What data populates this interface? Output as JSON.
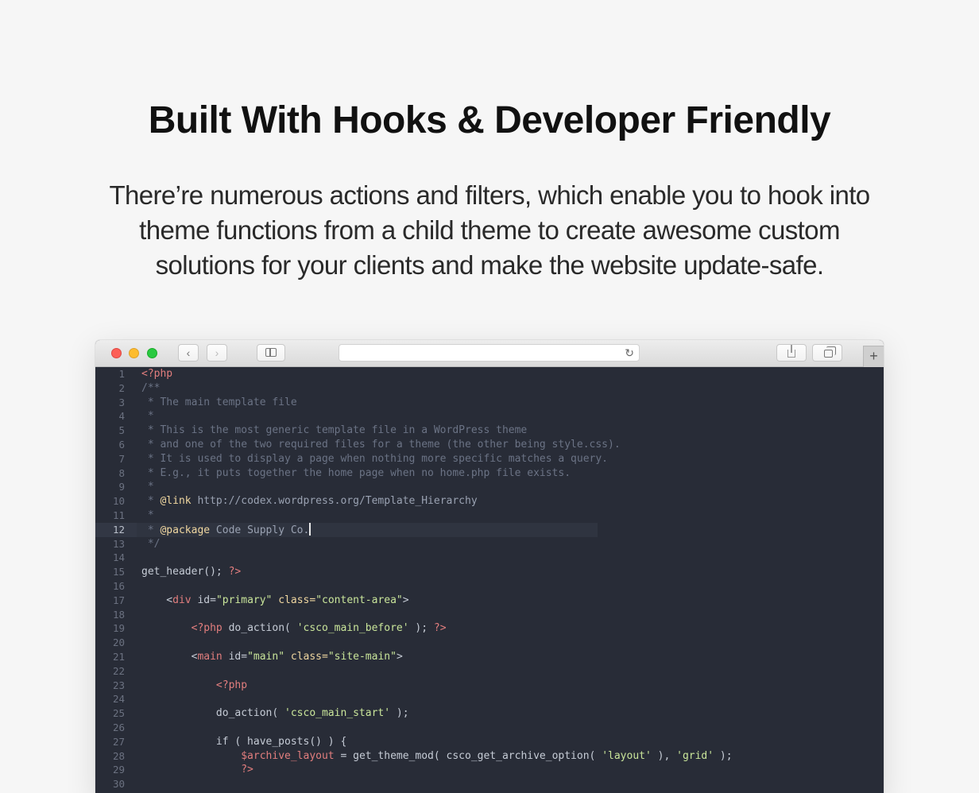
{
  "hero": {
    "title": "Built With Hooks & Developer Friendly",
    "subtitle_lines": [
      "There’re numerous actions and filters, which enable you to hook into",
      "theme functions from a child theme to create awesome custom",
      "solutions for your clients and make the website update-safe."
    ]
  },
  "browser": {
    "toolbar": {
      "back_icon": "chevron-left-icon",
      "forward_icon": "chevron-right-icon",
      "sidebar_icon": "sidebar-icon",
      "reload_icon": "reload-icon",
      "share_icon": "share-icon",
      "tabs_icon": "tabs-icon",
      "new_tab_label": "+",
      "address_value": ""
    },
    "colors": {
      "close": "#fc5f57",
      "minimize": "#fdbc2e",
      "maximize": "#29c941",
      "editor_bg": "#282c37"
    }
  },
  "editor": {
    "active_line": 12,
    "line_numbers": [
      "1",
      "2",
      "3",
      "4",
      "5",
      "6",
      "7",
      "8",
      "9",
      "10",
      "11",
      "12",
      "13",
      "14",
      "15",
      "16",
      "17",
      "18",
      "19",
      "20",
      "21",
      "22",
      "23",
      "24",
      "25",
      "26",
      "27",
      "28",
      "29",
      "30"
    ],
    "lines": [
      [
        {
          "t": "<?php",
          "c": "php"
        }
      ],
      [
        {
          "t": "/**",
          "c": "comment"
        }
      ],
      [
        {
          "t": " * The main template file",
          "c": "comment"
        }
      ],
      [
        {
          "t": " *",
          "c": "comment"
        }
      ],
      [
        {
          "t": " * This is the most generic template file in a WordPress theme",
          "c": "comment"
        }
      ],
      [
        {
          "t": " * and one of the two required files for a theme (the other being style.css).",
          "c": "comment"
        }
      ],
      [
        {
          "t": " * It is used to display a page when nothing more specific matches a query.",
          "c": "comment"
        }
      ],
      [
        {
          "t": " * E.g., it puts together the home page when no home.php file exists.",
          "c": "comment"
        }
      ],
      [
        {
          "t": " *",
          "c": "comment"
        }
      ],
      [
        {
          "t": " * ",
          "c": "comment"
        },
        {
          "t": "@link",
          "c": "doc"
        },
        {
          "t": " http://codex.wordpress.org/Template_Hierarchy",
          "c": "url"
        }
      ],
      [
        {
          "t": " *",
          "c": "comment"
        }
      ],
      [
        {
          "t": " * ",
          "c": "comment"
        },
        {
          "t": "@package",
          "c": "doc"
        },
        {
          "t": " Code Supply Co.",
          "c": "url"
        }
      ],
      [
        {
          "t": " */",
          "c": "comment"
        }
      ],
      [],
      [
        {
          "t": "get_header(); ",
          "c": "fn"
        },
        {
          "t": "?>",
          "c": "php"
        }
      ],
      [],
      [
        {
          "t": "    <",
          "c": "fn"
        },
        {
          "t": "div",
          "c": "tag"
        },
        {
          "t": " id=",
          "c": "fn"
        },
        {
          "t": "\"primary\"",
          "c": "str"
        },
        {
          "t": " ",
          "c": "fn"
        },
        {
          "t": "class=",
          "c": "attr"
        },
        {
          "t": "\"content-area\"",
          "c": "str"
        },
        {
          "t": ">",
          "c": "fn"
        }
      ],
      [],
      [
        {
          "t": "        ",
          "c": "fn"
        },
        {
          "t": "<?php",
          "c": "php"
        },
        {
          "t": " do_action( ",
          "c": "fn"
        },
        {
          "t": "'csco_main_before'",
          "c": "str"
        },
        {
          "t": " ); ",
          "c": "fn"
        },
        {
          "t": "?>",
          "c": "php"
        }
      ],
      [],
      [
        {
          "t": "        <",
          "c": "fn"
        },
        {
          "t": "main",
          "c": "tag"
        },
        {
          "t": " id=",
          "c": "fn"
        },
        {
          "t": "\"main\"",
          "c": "str"
        },
        {
          "t": " ",
          "c": "fn"
        },
        {
          "t": "class=",
          "c": "attr"
        },
        {
          "t": "\"site-main\"",
          "c": "str"
        },
        {
          "t": ">",
          "c": "fn"
        }
      ],
      [],
      [
        {
          "t": "            ",
          "c": "fn"
        },
        {
          "t": "<?php",
          "c": "php"
        }
      ],
      [],
      [
        {
          "t": "            do_action( ",
          "c": "fn"
        },
        {
          "t": "'csco_main_start'",
          "c": "str"
        },
        {
          "t": " );",
          "c": "fn"
        }
      ],
      [],
      [
        {
          "t": "            if ( have_posts() ) {",
          "c": "fn"
        }
      ],
      [
        {
          "t": "                ",
          "c": "fn"
        },
        {
          "t": "$archive_layout",
          "c": "var"
        },
        {
          "t": " = get_theme_mod( csco_get_archive_option( ",
          "c": "fn"
        },
        {
          "t": "'layout'",
          "c": "str"
        },
        {
          "t": " ), ",
          "c": "fn"
        },
        {
          "t": "'grid'",
          "c": "str"
        },
        {
          "t": " );",
          "c": "fn"
        }
      ],
      [
        {
          "t": "                ",
          "c": "fn"
        },
        {
          "t": "?>",
          "c": "php"
        }
      ],
      []
    ]
  }
}
